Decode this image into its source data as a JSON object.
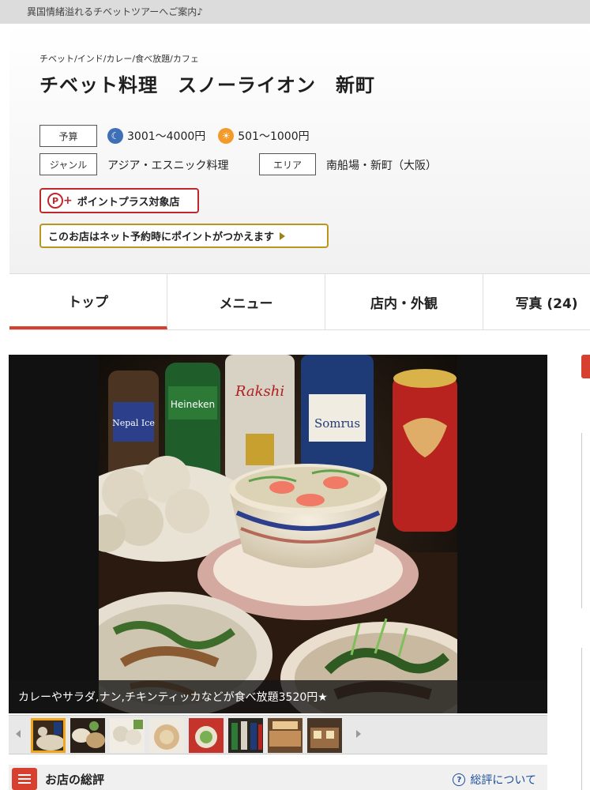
{
  "top_banner": "異国情緒溢れるチベットツアーへご案内♪",
  "breadcrumb": "チベット/インド/カレー/食べ放題/カフェ",
  "title": "チベット料理　スノーライオン　新町",
  "budget": {
    "label": "予算",
    "dinner": "3001〜4000円",
    "lunch": "501〜1000円",
    "dinner_icon": "moon-icon",
    "lunch_icon": "sun-icon"
  },
  "genre": {
    "label": "ジャンル",
    "value": "アジア・エスニック料理"
  },
  "area": {
    "label": "エリア",
    "value": "南船場・新町（大阪）"
  },
  "point_plus": "ポイントプラス対象店",
  "net_reserve": "このお店はネット予約時にポイントがつかえます",
  "tabs": [
    {
      "label": "トップ"
    },
    {
      "label": "メニュー"
    },
    {
      "label": "店内・外観"
    },
    {
      "label": "写真 (24)"
    }
  ],
  "photo": {
    "caption": "カレーやサラダ,ナン,チキンティッカなどが食べ放題3520円★",
    "bottle_labels": [
      "Nepal Ice",
      "Heineken",
      "Rakshi",
      "Somrus"
    ]
  },
  "thumbnails_count": 8,
  "review": {
    "title": "お店の総評",
    "link": "総評について"
  },
  "colors": {
    "accent": "#d7402f",
    "gold": "#b9961e",
    "link": "#1a4e99"
  }
}
